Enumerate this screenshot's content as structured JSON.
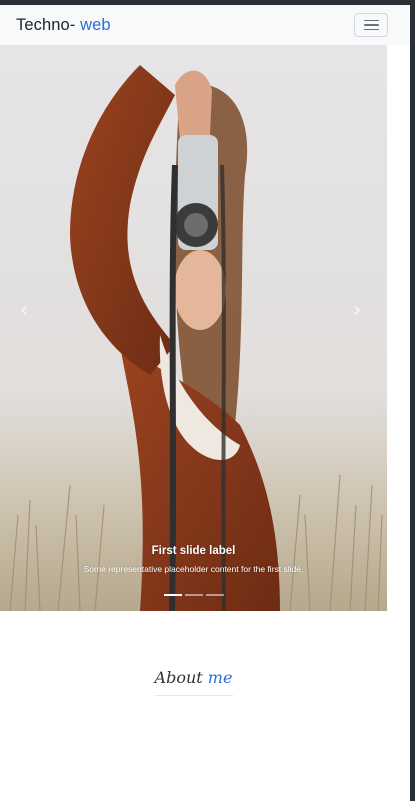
{
  "navbar": {
    "brand_main": "Techno- ",
    "brand_accent": "web",
    "toggler_icon": "hamburger-icon"
  },
  "carousel": {
    "slides": [
      {
        "label": "First slide label",
        "text": "Some representative placeholder content for the first slide."
      },
      {
        "label": "",
        "text": ""
      },
      {
        "label": "",
        "text": ""
      }
    ],
    "active_index": 0,
    "prev_icon": "chevron-left-icon",
    "next_icon": "chevron-right-icon",
    "prev_glyph": "‹",
    "next_glyph": "›"
  },
  "about": {
    "title_main": "About ",
    "title_accent": "me"
  },
  "colors": {
    "accent": "#2a6fd6",
    "navbar_bg": "#f8f9fa"
  }
}
